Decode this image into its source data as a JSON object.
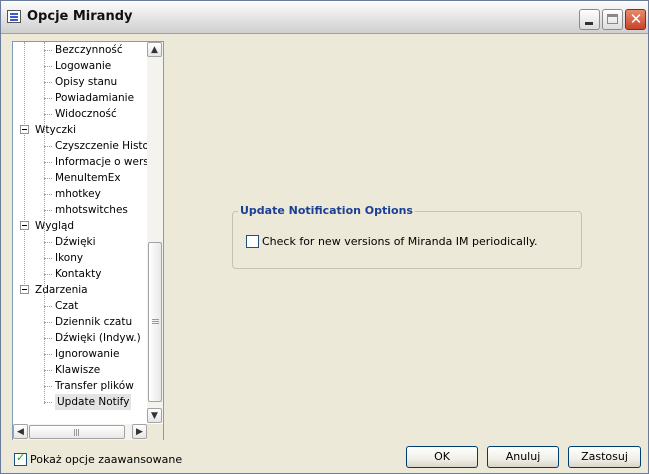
{
  "window": {
    "title": "Opcje Mirandy"
  },
  "tree": {
    "items": [
      {
        "label": "Bezczynność",
        "level": 2
      },
      {
        "label": "Logowanie",
        "level": 2
      },
      {
        "label": "Opisy stanu",
        "level": 2
      },
      {
        "label": "Powiadamianie",
        "level": 2
      },
      {
        "label": "Widoczność",
        "level": 2
      },
      {
        "label": "Wtyczki",
        "level": 1,
        "expanded": true
      },
      {
        "label": "Czyszczenie Histori",
        "level": 2
      },
      {
        "label": "Informacje o wersji",
        "level": 2
      },
      {
        "label": "MenuItemEx",
        "level": 2
      },
      {
        "label": "mhotkey",
        "level": 2
      },
      {
        "label": "mhotswitches",
        "level": 2
      },
      {
        "label": "Wygląd",
        "level": 1,
        "expanded": true
      },
      {
        "label": "Dźwięki",
        "level": 2
      },
      {
        "label": "Ikony",
        "level": 2
      },
      {
        "label": "Kontakty",
        "level": 2
      },
      {
        "label": "Zdarzenia",
        "level": 1,
        "expanded": true
      },
      {
        "label": "Czat",
        "level": 2
      },
      {
        "label": "Dziennik czatu",
        "level": 2
      },
      {
        "label": "Dźwięki (Indyw.)",
        "level": 2
      },
      {
        "label": "Ignorowanie",
        "level": 2
      },
      {
        "label": "Klawisze",
        "level": 2
      },
      {
        "label": "Transfer plików",
        "level": 2
      },
      {
        "label": "Update Notify",
        "level": 2,
        "selected": true
      }
    ]
  },
  "panel": {
    "group_title": "Update Notification Options",
    "check_label": "Check for new versions of Miranda IM periodically.",
    "checked": false
  },
  "advanced": {
    "label": "Pokaż opcje zaawansowane",
    "checked": true
  },
  "buttons": {
    "ok": "OK",
    "cancel": "Anuluj",
    "apply": "Zastosuj"
  },
  "colors": {
    "group_title": "#1c3f95",
    "accent": "#003c74"
  }
}
